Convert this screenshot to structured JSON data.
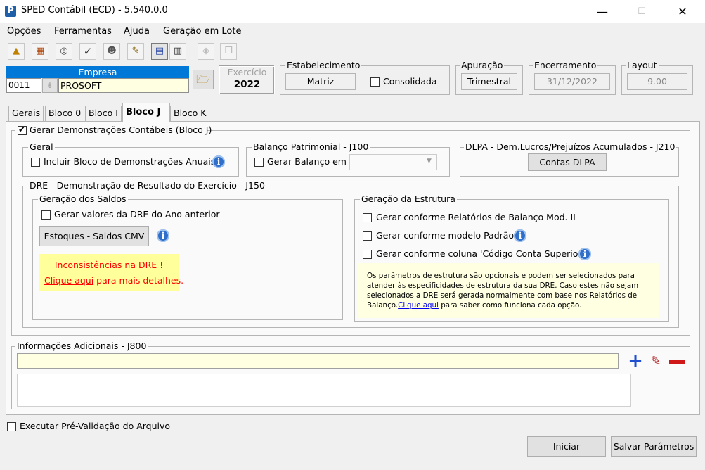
{
  "window": {
    "title": "SPED Contábil (ECD) - 5.540.0.0",
    "app_icon": "P",
    "minimize": "—",
    "maximize": "☐",
    "close": "✕"
  },
  "menu": {
    "items": [
      "Opções",
      "Ferramentas",
      "Ajuda",
      "Geração em Lote"
    ]
  },
  "empresa": {
    "label": "Empresa",
    "code": "0011",
    "name": "PROSOFT"
  },
  "exercicio": {
    "label": "Exercício",
    "value": "2022"
  },
  "estabelecimento": {
    "label": "Estabelecimento",
    "value": "Matriz",
    "consolidada_label": "Consolidada"
  },
  "apuracao": {
    "label": "Apuração",
    "value": "Trimestral"
  },
  "encerramento": {
    "label": "Encerramento",
    "value": "31/12/2022"
  },
  "layout": {
    "label": "Layout",
    "value": "9.00"
  },
  "tabs": [
    "Gerais",
    "Bloco 0",
    "Bloco I",
    "Bloco J",
    "Bloco K"
  ],
  "bloco_j": {
    "gerar_label": "Gerar Demonstrações Contábeis (Bloco J)",
    "geral": {
      "label": "Geral",
      "incluir_label": "Incluir Bloco de Demonstrações Anuais"
    },
    "balanco": {
      "label": "Balanço Patrimonial - J100",
      "gerar_label": "Gerar Balanço em",
      "select_value": ""
    },
    "dlpa": {
      "label": "DLPA - Dem.Lucros/Prejuízos Acumulados - J210",
      "button": "Contas DLPA"
    },
    "dre": {
      "label": "DRE - Demonstração de Resultado do Exercício - J150",
      "saldos": {
        "label": "Geração dos Saldos",
        "gerar_label": "Gerar valores da DRE do Ano anterior",
        "estoques_button": "Estoques - Saldos CMV",
        "warning_title": "Inconsistências na DRE !",
        "warning_link": "Clique aqui",
        "warning_text": " para mais detalhes."
      },
      "estrutura": {
        "label": "Geração da Estrutura",
        "opt1": "Gerar conforme Relatórios de Balanço Mod. II",
        "opt2": "Gerar conforme modelo Padrão",
        "opt3": "Gerar conforme coluna 'Código Conta Superior'",
        "note_text": "Os parâmetros de estrutura são opcionais e podem ser selecionados para atender às especificidades de estrutura da sua DRE. Caso estes não sejam selecionados a DRE será gerada normalmente com base nos Relatórios de Balanço.",
        "note_link": "Clique aqui",
        "note_tail": " para saber como funciona cada opção."
      }
    },
    "info": {
      "label": "Informações Adicionais - J800",
      "input_value": ""
    }
  },
  "footer": {
    "prevalidacao_label": "Executar Pré-Validação do Arquivo",
    "iniciar": "Iniciar",
    "salvar": "Salvar Parâmetros"
  },
  "colors": {
    "empresa_header": "#0078d7",
    "warning_bg": "#ffff9c",
    "warning_text": "#ff0000",
    "note_bg": "#ffffe1",
    "info_blue": "#2f6fc9"
  }
}
